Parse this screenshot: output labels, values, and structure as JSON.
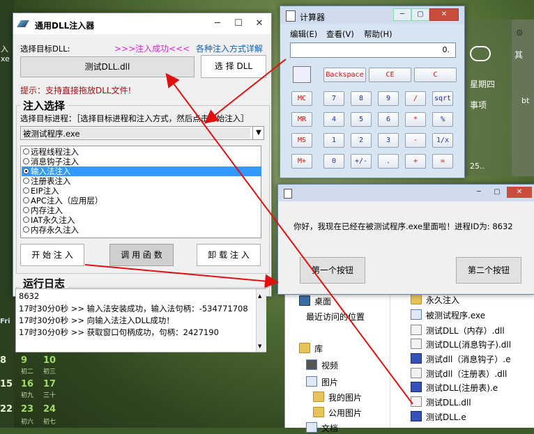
{
  "desktop": {
    "left_labels": [
      "入",
      "xe"
    ],
    "calendar": {
      "day_header": "Fri",
      "rows": [
        [
          "8",
          "9",
          "10"
        ],
        [
          "15",
          "16",
          "17"
        ],
        [
          "22",
          "23",
          "24"
        ]
      ],
      "subs": [
        [
          "",
          "初二",
          "初三"
        ],
        [
          "",
          "初九",
          "三十"
        ],
        [
          "",
          "初六",
          "初七"
        ]
      ]
    },
    "widget": {
      "weekday": "星期四",
      "events": "事项",
      "num": "25..",
      "right1": "其",
      "right2": "bt"
    }
  },
  "main_window": {
    "title": "通用DLL注入器",
    "select_dll_label": "选择目标DLL:",
    "status": ">>>注入成功<<<",
    "help_link": "各种注入方式详解",
    "dll_path": "测试DLL.dll",
    "select_dll_button": "选 择 DLL",
    "hint": "提示：支持直接拖放DLL文件!",
    "inject_group_title": "注入选择",
    "process_label": "选择目标进程：［选择目标进程和注入方式，然后点击开始注入］",
    "process_selected": "被测试程序.exe",
    "methods": [
      "远程线程注入",
      "消息钩子注入",
      "输入法注入",
      "注册表注入",
      "EIP注入",
      "APC注入（应用层）",
      "内存注入",
      "IAT永久注入",
      "内存永久注入"
    ],
    "selected_method_index": 2,
    "start_button": "开 始 注 入",
    "call_button": "调 用 函 数",
    "unload_button": "卸 载 注 入",
    "log_group_title": "运行日志",
    "log_lines": [
      "8632",
      "17时30分0秒 >> 输入法安装成功，输入法句柄：-534771708",
      "17时30分0秒 >> 向输入法注入DLL成功！",
      "17时30分0秒 >> 获取窗口句柄成功，句柄：2427190"
    ]
  },
  "calculator": {
    "title": "计算器",
    "menu": [
      "编辑(E)",
      "查看(V)",
      "帮助(H)"
    ],
    "display": "0.",
    "row0": [
      "Backspace",
      "CE",
      "C"
    ],
    "mem": [
      "MC",
      "MR",
      "MS",
      "M+"
    ],
    "rows": [
      [
        "7",
        "8",
        "9",
        "/",
        "sqrt"
      ],
      [
        "4",
        "5",
        "6",
        "*",
        "%"
      ],
      [
        "1",
        "2",
        "3",
        "-",
        "1/x"
      ],
      [
        "0",
        "+/-",
        ".",
        "+",
        "="
      ]
    ]
  },
  "message_box": {
    "text": "你好，我现在已经在被测试程序.exe里面啦！进程ID为: 8632",
    "button1": "第一个按钮",
    "button2": "第二个按钮"
  },
  "explorer": {
    "left_items": [
      "桌面",
      "最近访问的位置",
      "库",
      "视频",
      "图片",
      "我的图片",
      "公用图片",
      "文档"
    ],
    "right_items": [
      "永久注入",
      "被测试程序.exe",
      "测试DLL（内存）.dll",
      "测试DLL(消息钩子).dll",
      "测试dll（消息钩子）.e",
      "测试dll（注册表）.dll",
      "测试DLL(注册表).e",
      "测试DLL.dll",
      "测试DLL.e"
    ]
  },
  "colors": {
    "status": "#e020e0",
    "help_link": "#1060c0",
    "hint": "#a01010",
    "selection": "#3399ff",
    "arrows": "#e01010"
  }
}
